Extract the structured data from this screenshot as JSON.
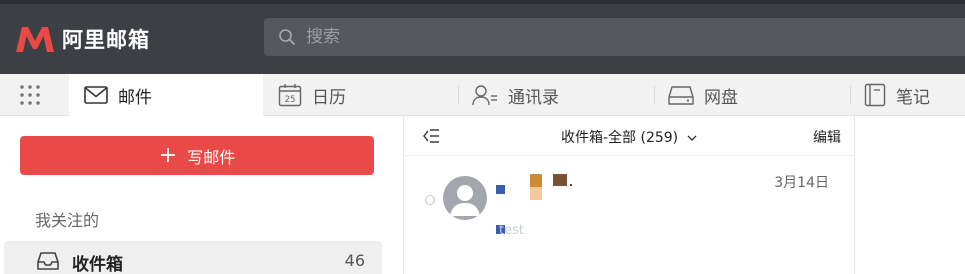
{
  "app": {
    "logo_text": "阿里邮箱",
    "brand_color": "#ea4a47"
  },
  "search": {
    "placeholder": "搜索"
  },
  "tabs": [
    {
      "label": "邮件",
      "icon": "mail-icon"
    },
    {
      "label": "日历",
      "icon": "calendar-icon",
      "icon_text": "25"
    },
    {
      "label": "通讯录",
      "icon": "contacts-icon"
    },
    {
      "label": "网盘",
      "icon": "drive-icon"
    },
    {
      "label": "笔记",
      "icon": "notes-icon"
    }
  ],
  "sidebar": {
    "compose_label": "写邮件",
    "section_title": "我关注的",
    "folders": [
      {
        "name": "收件箱",
        "count": "46"
      }
    ]
  },
  "mail_list": {
    "title": "收件箱-全部 (259)",
    "edit_label": "编辑",
    "items": [
      {
        "date": "3月14日",
        "preview": "test"
      }
    ]
  }
}
